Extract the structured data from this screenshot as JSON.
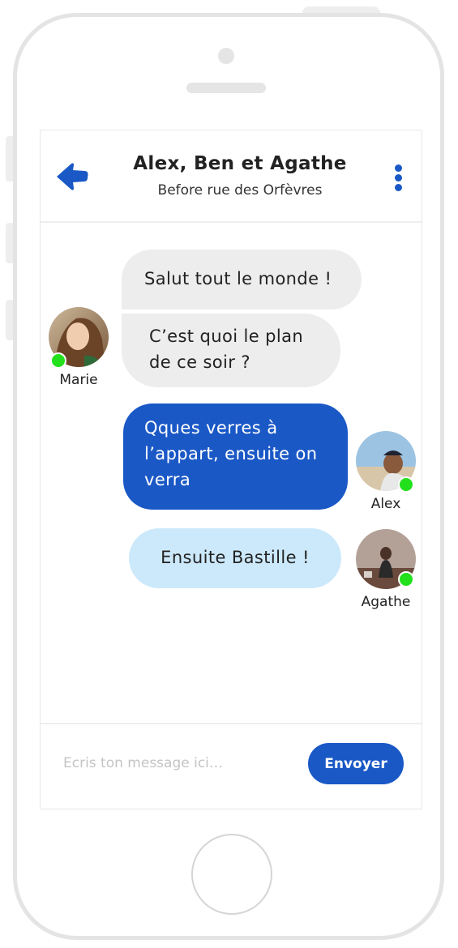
{
  "header": {
    "title": "Alex, Ben et Agathe",
    "subtitle": "Before rue des Orfèvres",
    "back_icon": "back-arrow-icon",
    "menu_icon": "more-vertical-icon"
  },
  "messages": [
    {
      "sender": "Marie",
      "text": "Salut tout le monde !",
      "style": "received"
    },
    {
      "sender": "Marie",
      "text": "C’est quoi le plan de ce soir ?",
      "style": "received"
    },
    {
      "sender": "Alex",
      "text": "Qques verres à l’appart, ensuite on verra",
      "style": "sent"
    },
    {
      "sender": "Agathe",
      "text": "Ensuite Bastille !",
      "style": "sent-light"
    }
  ],
  "participants": [
    {
      "name": "Marie",
      "online": true
    },
    {
      "name": "Alex",
      "online": true
    },
    {
      "name": "Agathe",
      "online": true
    }
  ],
  "composer": {
    "placeholder": "Ecris ton message ici…",
    "value": "",
    "send_label": "Envoyer"
  },
  "colors": {
    "primary": "#1a58c6",
    "received_bubble": "#ededed",
    "light_bubble": "#cce9fb",
    "online": "#22e01b",
    "frame": "#e4e4e4"
  }
}
